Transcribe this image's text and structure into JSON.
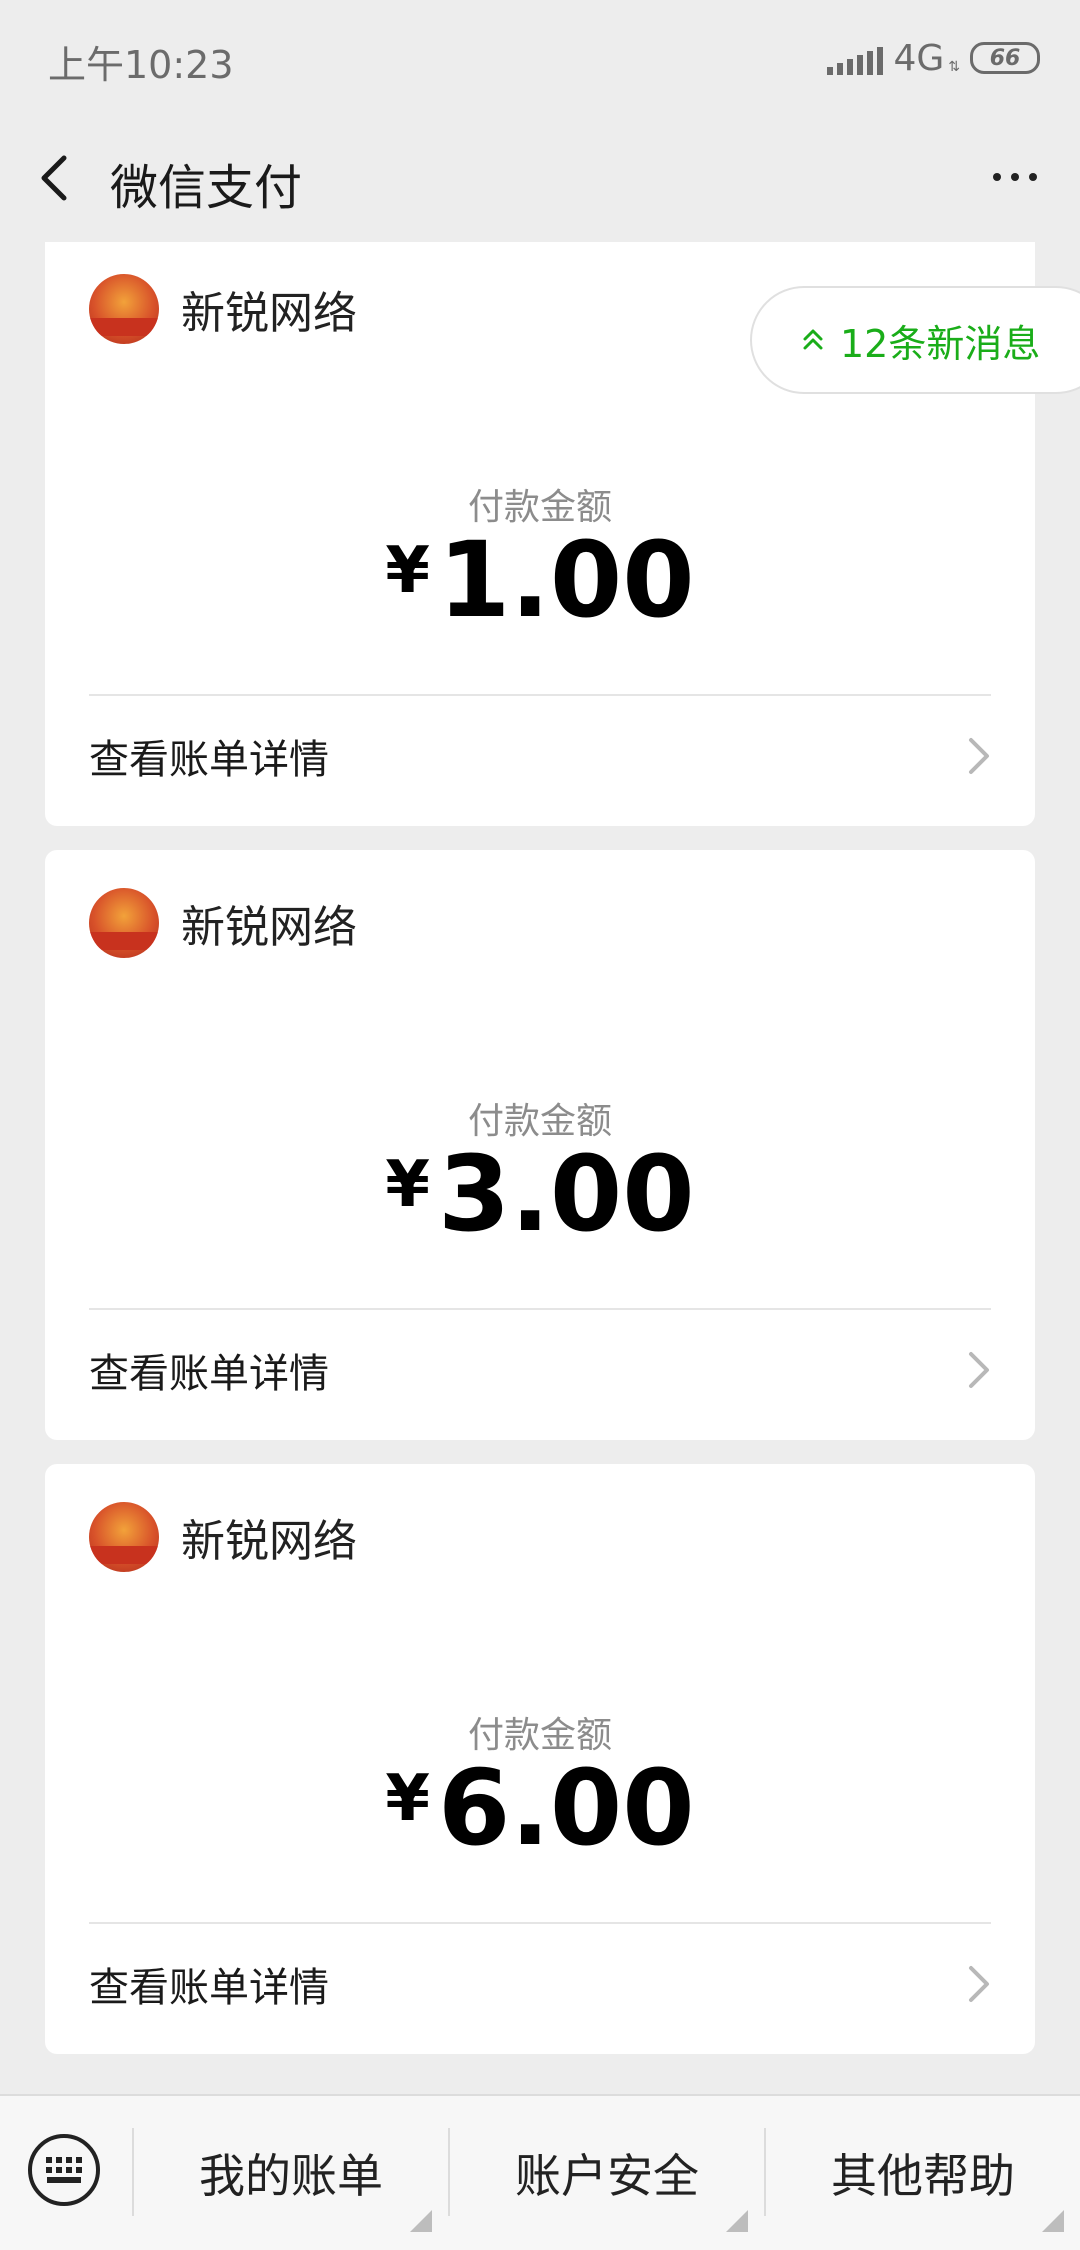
{
  "status_bar": {
    "time": "上午10:23",
    "network": "4G",
    "battery": "66"
  },
  "nav": {
    "title": "微信支付"
  },
  "new_messages": {
    "label": "12条新消息"
  },
  "cards": [
    {
      "merchant": "新锐网络",
      "amount_label": "付款金额",
      "currency": "¥",
      "amount": "1.00",
      "detail_label": "查看账单详情"
    },
    {
      "merchant": "新锐网络",
      "amount_label": "付款金额",
      "currency": "¥",
      "amount": "3.00",
      "detail_label": "查看账单详情"
    },
    {
      "merchant": "新锐网络",
      "amount_label": "付款金额",
      "currency": "¥",
      "amount": "6.00",
      "detail_label": "查看账单详情"
    }
  ],
  "bottom_menu": {
    "items": [
      {
        "label": "我的账单"
      },
      {
        "label": "账户安全"
      },
      {
        "label": "其他帮助"
      }
    ]
  },
  "colors": {
    "accent_green": "#1aad19",
    "background": "#ededed"
  }
}
